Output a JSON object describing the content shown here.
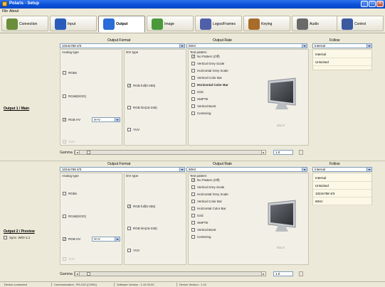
{
  "window": {
    "title": "Polaris - Setup",
    "min": "_",
    "max": "□",
    "close": "×"
  },
  "menu": [
    "File",
    "About"
  ],
  "tabs": [
    {
      "label": "Connection",
      "icon": "connection-icon",
      "color": "#6b8e3a"
    },
    {
      "label": "Input",
      "icon": "input-icon",
      "color": "#2a5cba"
    },
    {
      "label": "Output",
      "icon": "output-icon",
      "color": "#2a6cd8"
    },
    {
      "label": "Image",
      "icon": "image-icon",
      "color": "#4a9a3a"
    },
    {
      "label": "Logos/Frames",
      "icon": "logos-frames-icon",
      "color": "#5060a8"
    },
    {
      "label": "Keying",
      "icon": "keying-icon",
      "color": "#a86c2a"
    },
    {
      "label": "Audio",
      "icon": "audio-icon",
      "color": "#6a6a6a"
    },
    {
      "label": "Control",
      "icon": "control-icon",
      "color": "#3a5aa0"
    }
  ],
  "panels": [
    {
      "label": "Output 1 / Main",
      "output_format_header": "Output Format",
      "output_format_value": "1024x768 4/3",
      "output_rate_header": "Output Rate",
      "output_rate_value": "60Hz",
      "follow_header": "Follow",
      "follow_value": "Internal",
      "follow_list": [
        "Internal",
        "Unlocked"
      ],
      "analog_group": "Analog type",
      "analog_options": [
        {
          "label": "RGBs",
          "checked": false,
          "disabled": false
        },
        {
          "label": "RGsB(SOG)",
          "checked": false,
          "disabled": false
        },
        {
          "label": "RGB HV",
          "checked": true,
          "disabled": false
        },
        {
          "label": "YUV",
          "checked": false,
          "disabled": true
        }
      ],
      "hv_select": "H+V",
      "dvi_group": "DVI type",
      "dvi_options": [
        {
          "label": "RGB full(0-255)",
          "checked": true
        },
        {
          "label": "RGB lim(16-235)",
          "checked": false
        },
        {
          "label": "YUV",
          "checked": false
        }
      ],
      "test_group": "Test pattern",
      "test_options": [
        {
          "label": "No Pattern (Off)",
          "checked": true,
          "bold": false
        },
        {
          "label": "Vertical Grey Scale",
          "checked": false,
          "bold": false
        },
        {
          "label": "Horizontal Grey Scale",
          "checked": false,
          "bold": false
        },
        {
          "label": "Vertical Color Bar",
          "checked": false,
          "bold": false
        },
        {
          "label": "Horizontal Color Bar",
          "checked": false,
          "bold": true
        },
        {
          "label": "Grid",
          "checked": false,
          "bold": false
        },
        {
          "label": "SMPTE",
          "checked": false,
          "bold": false
        },
        {
          "label": "Vertical Burst",
          "checked": false,
          "bold": false
        },
        {
          "label": "Centering",
          "checked": false,
          "bold": false
        }
      ],
      "monitor_caption": "Black",
      "gamma_label": "Gamma",
      "gamma_value": "1.0",
      "gamma_level": 0.04,
      "sync_label": ""
    },
    {
      "label": "Output 2 / Preview",
      "output_format_header": "Output Format",
      "output_format_value": "1024x768 4/3",
      "output_rate_header": "Output Rate",
      "output_rate_value": "60Hz",
      "follow_header": "Follow",
      "follow_value": "Internal",
      "follow_list": [
        "Internal",
        "Unlocked",
        "1024x768 4/3",
        "60Hz"
      ],
      "analog_group": "Analog type",
      "analog_options": [
        {
          "label": "RGBs",
          "checked": false,
          "disabled": false
        },
        {
          "label": "RGsB(SOG)",
          "checked": false,
          "disabled": false
        },
        {
          "label": "RGB HV",
          "checked": true,
          "disabled": false
        },
        {
          "label": "YUV",
          "checked": false,
          "disabled": true
        }
      ],
      "hv_select": "H+V",
      "dvi_group": "DVI type",
      "dvi_options": [
        {
          "label": "RGB full(0-255)",
          "checked": true
        },
        {
          "label": "RGB lim(16-235)",
          "checked": false
        },
        {
          "label": "YUV",
          "checked": false
        }
      ],
      "test_group": "Test pattern",
      "test_options": [
        {
          "label": "No Pattern (Off)",
          "checked": true,
          "bold": false
        },
        {
          "label": "Vertical Grey Scale",
          "checked": false,
          "bold": false
        },
        {
          "label": "Horizontal Grey Scale",
          "checked": false,
          "bold": false
        },
        {
          "label": "Vertical Color Bar",
          "checked": false,
          "bold": false
        },
        {
          "label": "Horizontal Color Bar",
          "checked": false,
          "bold": false
        },
        {
          "label": "Grid",
          "checked": false,
          "bold": false
        },
        {
          "label": "SMPTE",
          "checked": false,
          "bold": false
        },
        {
          "label": "Vertical Burst",
          "checked": false,
          "bold": false
        },
        {
          "label": "Centering",
          "checked": false,
          "bold": false
        }
      ],
      "monitor_caption": "Black",
      "gamma_label": "Gamma",
      "gamma_value": "1.0",
      "gamma_level": 0.04,
      "sync_label": "Sync. W/O-1:1"
    }
  ],
  "status": {
    "connected": "Device connected",
    "communication": "Communication : RS-232 (COM1)",
    "software": "Software Version : 1.10.00.00",
    "device": "Device Version : 1.10"
  },
  "colors": {
    "titlebar": "#0a4fd6",
    "checkmark": "#1b4f1b",
    "accent": "#7f9db9"
  }
}
